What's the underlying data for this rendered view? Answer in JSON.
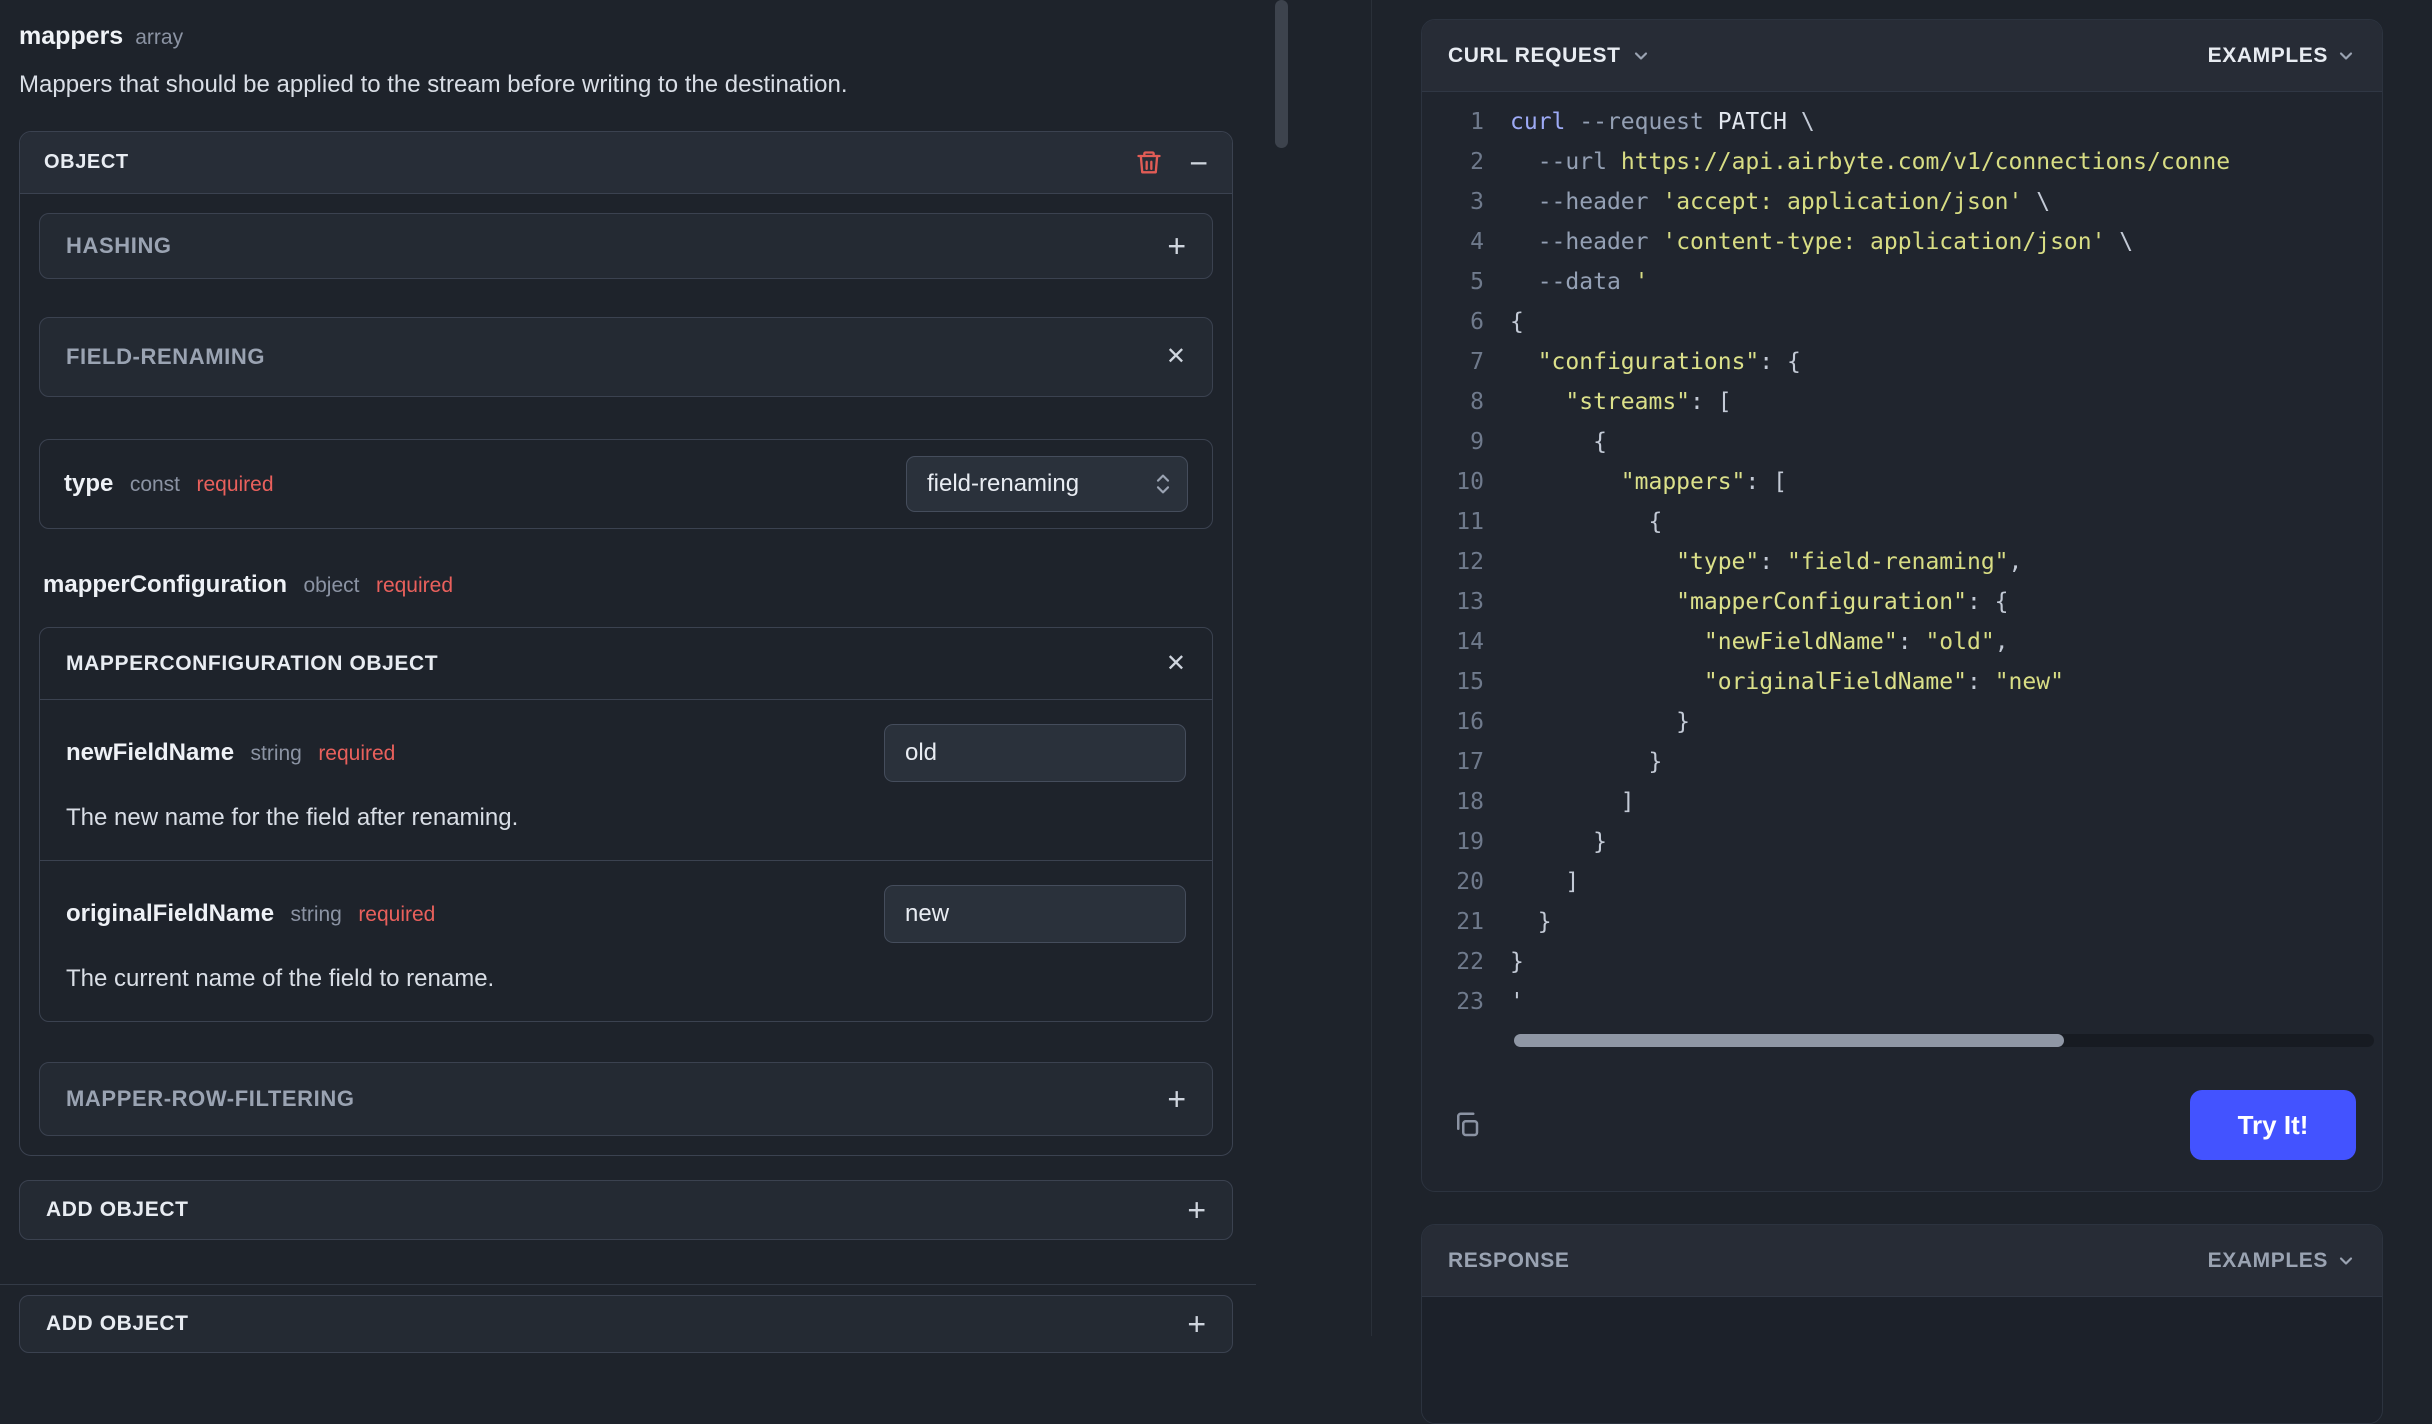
{
  "colors": {
    "accent": "#4353ff",
    "required": "#e9605c",
    "code_string": "#d8dd84",
    "trash": "#e25c56"
  },
  "left": {
    "field_name": "mappers",
    "field_type": "array",
    "description": "Mappers that should be applied to the stream before writing to the destination.",
    "object_card_title": "OBJECT",
    "minus_sign": "−",
    "plus_sign": "+",
    "close_sign": "✕",
    "hashing_title": "HASHING",
    "field_renaming_title": "FIELD-RENAMING",
    "type_row": {
      "name": "type",
      "kind": "const",
      "required": "required",
      "value": "field-renaming"
    },
    "mapper_config": {
      "name": "mapperConfiguration",
      "kind": "object",
      "required": "required"
    },
    "mc_title": "MAPPERCONFIGURATION OBJECT",
    "mc_fields": [
      {
        "name": "newFieldName",
        "kind": "string",
        "required": "required",
        "value": "old",
        "description": "The new name for the field after renaming."
      },
      {
        "name": "originalFieldName",
        "kind": "string",
        "required": "required",
        "value": "new",
        "description": "The current name of the field to rename."
      }
    ],
    "mapper_row_filtering_title": "MAPPER-ROW-FILTERING",
    "add_object_inner": "ADD OBJECT",
    "add_object_outer": "ADD OBJECT"
  },
  "right": {
    "curl_title": "CURL REQUEST",
    "examples_label": "EXAMPLES",
    "try_label": "Try It!",
    "response_title": "RESPONSE",
    "response_examples_label": "EXAMPLES",
    "code_lines": [
      [
        [
          "cmd",
          "curl"
        ],
        [
          "pln",
          " "
        ],
        [
          "flag",
          "--request"
        ],
        [
          "pln",
          " "
        ],
        [
          "arg",
          "PATCH"
        ],
        [
          "pln",
          " \\"
        ]
      ],
      [
        [
          "pln",
          "  "
        ],
        [
          "flag",
          "--url"
        ],
        [
          "pln",
          " "
        ],
        [
          "str",
          "https://api.airbyte.com/v1/connections/conne"
        ]
      ],
      [
        [
          "pln",
          "  "
        ],
        [
          "flag",
          "--header"
        ],
        [
          "pln",
          " "
        ],
        [
          "str",
          "'accept: application/json'"
        ],
        [
          "pln",
          " \\"
        ]
      ],
      [
        [
          "pln",
          "  "
        ],
        [
          "flag",
          "--header"
        ],
        [
          "pln",
          " "
        ],
        [
          "str",
          "'content-type: application/json'"
        ],
        [
          "pln",
          " \\"
        ]
      ],
      [
        [
          "pln",
          "  "
        ],
        [
          "flag",
          "--data"
        ],
        [
          "pln",
          " "
        ],
        [
          "str",
          "'"
        ]
      ],
      [
        [
          "pln",
          "{"
        ]
      ],
      [
        [
          "pln",
          "  "
        ],
        [
          "key",
          "\"configurations\""
        ],
        [
          "pln",
          ": {"
        ]
      ],
      [
        [
          "pln",
          "    "
        ],
        [
          "key",
          "\"streams\""
        ],
        [
          "pln",
          ": ["
        ]
      ],
      [
        [
          "pln",
          "      {"
        ]
      ],
      [
        [
          "pln",
          "        "
        ],
        [
          "key",
          "\"mappers\""
        ],
        [
          "pln",
          ": ["
        ]
      ],
      [
        [
          "pln",
          "          {"
        ]
      ],
      [
        [
          "pln",
          "            "
        ],
        [
          "key",
          "\"type\""
        ],
        [
          "pln",
          ": "
        ],
        [
          "str",
          "\"field-renaming\""
        ],
        [
          "pln",
          ","
        ]
      ],
      [
        [
          "pln",
          "            "
        ],
        [
          "key",
          "\"mapperConfiguration\""
        ],
        [
          "pln",
          ": {"
        ]
      ],
      [
        [
          "pln",
          "              "
        ],
        [
          "key",
          "\"newFieldName\""
        ],
        [
          "pln",
          ": "
        ],
        [
          "str",
          "\"old\""
        ],
        [
          "pln",
          ","
        ]
      ],
      [
        [
          "pln",
          "              "
        ],
        [
          "key",
          "\"originalFieldName\""
        ],
        [
          "pln",
          ": "
        ],
        [
          "str",
          "\"new\""
        ]
      ],
      [
        [
          "pln",
          "            }"
        ]
      ],
      [
        [
          "pln",
          "          }"
        ]
      ],
      [
        [
          "pln",
          "        ]"
        ]
      ],
      [
        [
          "pln",
          "      }"
        ]
      ],
      [
        [
          "pln",
          "    ]"
        ]
      ],
      [
        [
          "pln",
          "  }"
        ]
      ],
      [
        [
          "pln",
          "}"
        ]
      ],
      [
        [
          "pln",
          "'"
        ]
      ]
    ]
  }
}
